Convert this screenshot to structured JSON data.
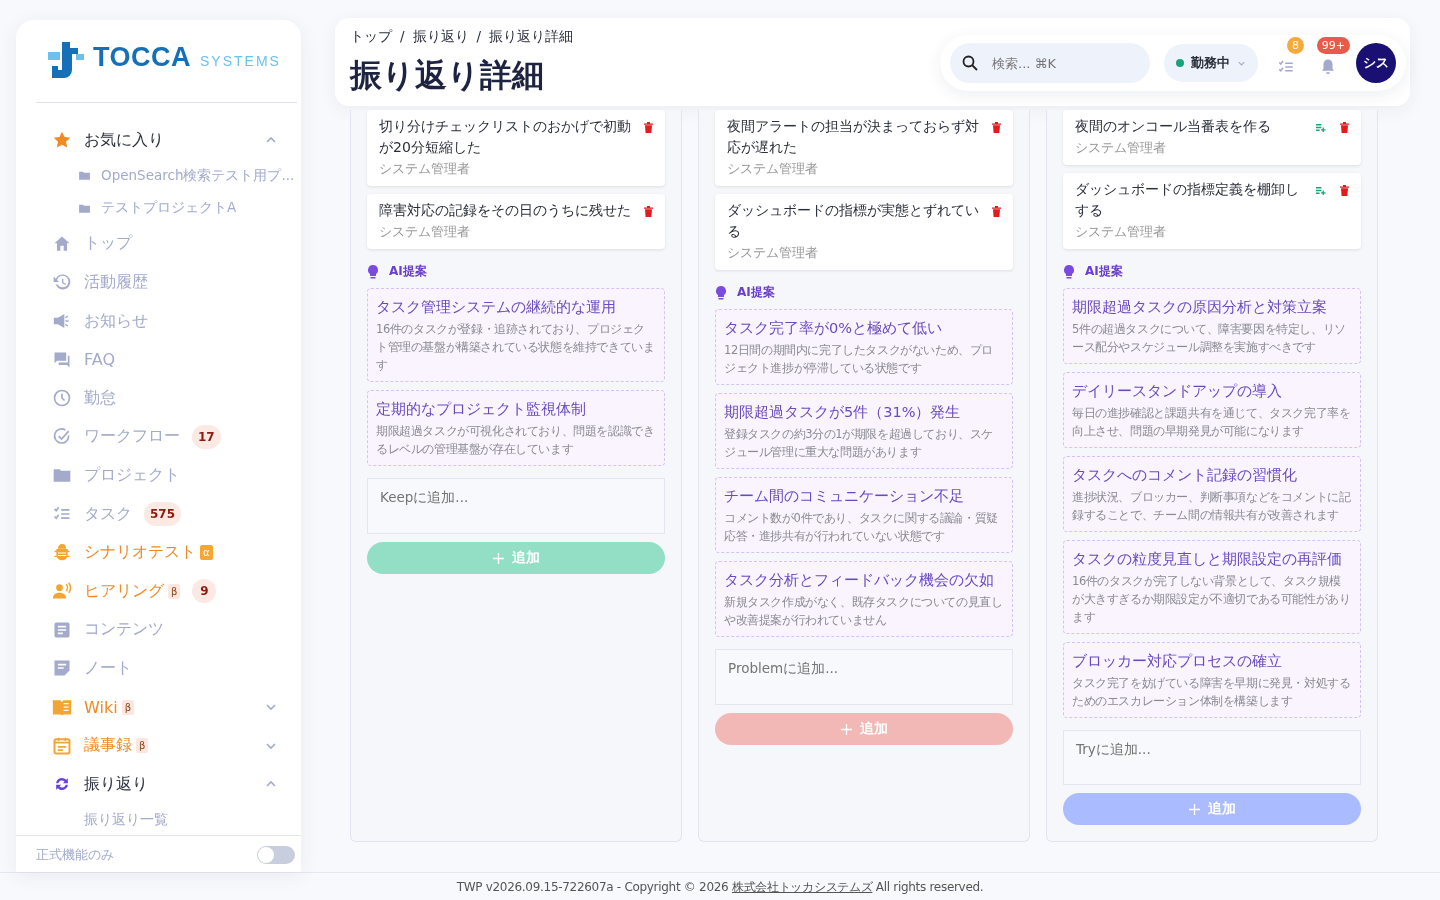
{
  "sidebar": {
    "logo": {
      "name": "TOCCA",
      "sub": "SYSTEMS"
    },
    "items": [
      {
        "label": "お気に入り",
        "expanded": true,
        "accent": false,
        "children": [
          {
            "label": "OpenSearch検索テスト用プ...",
            "kind": "project"
          },
          {
            "label": "テストプロジェクトA",
            "kind": "project"
          }
        ]
      },
      {
        "label": "トップ",
        "accent": false
      },
      {
        "label": "活動履歴",
        "accent": false
      },
      {
        "label": "お知らせ",
        "accent": false
      },
      {
        "label": "FAQ",
        "accent": false
      },
      {
        "label": "勤怠",
        "accent": false
      },
      {
        "label": "ワークフロー",
        "accent": false,
        "count": "17"
      },
      {
        "label": "プロジェクト",
        "accent": false
      },
      {
        "label": "タスク",
        "accent": false,
        "count": "575"
      },
      {
        "label": "シナリオテスト",
        "accent": true,
        "tag": {
          "text": "α",
          "kind": "alpha"
        }
      },
      {
        "label": "ヒアリング",
        "accent": true,
        "tag": {
          "text": "β",
          "kind": "beta"
        },
        "count": "9"
      },
      {
        "label": "コンテンツ",
        "accent": false
      },
      {
        "label": "ノート",
        "accent": false
      },
      {
        "label": "Wiki",
        "accent": true,
        "tag": {
          "text": "β",
          "kind": "beta"
        },
        "expanded": false
      },
      {
        "label": "議事録",
        "accent": true,
        "tag": {
          "text": "β",
          "kind": "beta"
        },
        "expanded": false
      },
      {
        "label": "振り返り",
        "accent": false,
        "expanded": true,
        "children": [
          {
            "label": "振り返り一覧",
            "kind": "page"
          }
        ]
      }
    ],
    "footer": {
      "label": "正式機能のみ",
      "on": false
    }
  },
  "header": {
    "breadcrumb": [
      "トップ",
      "振り返り",
      "振り返り詳細"
    ],
    "separator": "/",
    "title": "振り返り詳細",
    "search": {
      "placeholder": "検索... ⌘K"
    },
    "status": {
      "label": "勤務中",
      "color": "#1aa37a"
    },
    "task_badge": "8",
    "notification_badge": "99+",
    "avatar": "シス"
  },
  "columns": [
    {
      "kind": "keep",
      "cards": [
        {
          "text": "切り分けチェックリストのおかげで初動が20分短縮した",
          "author": "システム管理者",
          "can_add_task": false
        },
        {
          "text": "障害対応の記録をその日のうちに残せた",
          "author": "システム管理者",
          "can_add_task": false
        }
      ],
      "ai_label": "AI提案",
      "suggestions": [
        {
          "title": "タスク管理システムの継続的な運用",
          "body": "16件のタスクが登録・追跡されており、プロジェクト管理の基盤が構築されている状態を維持できています"
        },
        {
          "title": "定期的なプロジェクト監視体制",
          "body": "期限超過タスクが可視化されており、問題を認識できるレベルの管理基盤が存在しています"
        }
      ],
      "placeholder": "Keepに追加...",
      "button": "追加"
    },
    {
      "kind": "problem",
      "cards": [
        {
          "text": "夜間アラートの担当が決まっておらず対応が遅れた",
          "author": "システム管理者",
          "can_add_task": false
        },
        {
          "text": "ダッシュボードの指標が実態とずれている",
          "author": "システム管理者",
          "can_add_task": false
        }
      ],
      "ai_label": "AI提案",
      "suggestions": [
        {
          "title": "タスク完了率が0%と極めて低い",
          "body": "12日間の期間内に完了したタスクがないため、プロジェクト進捗が停滞している状態です"
        },
        {
          "title": "期限超過タスクが5件（31%）発生",
          "body": "登録タスクの約3分の1が期限を超過しており、スケジュール管理に重大な問題があります"
        },
        {
          "title": "チーム間のコミュニケーション不足",
          "body": "コメント数が0件であり、タスクに関する議論・質疑応答・進捗共有が行われていない状態です"
        },
        {
          "title": "タスク分析とフィードバック機会の欠如",
          "body": "新規タスク作成がなく、既存タスクについての見直しや改善提案が行われていません"
        }
      ],
      "placeholder": "Problemに追加...",
      "button": "追加"
    },
    {
      "kind": "try",
      "cards": [
        {
          "text": "夜間のオンコール当番表を作る",
          "author": "システム管理者",
          "can_add_task": true
        },
        {
          "text": "ダッシュボードの指標定義を棚卸しする",
          "author": "システム管理者",
          "can_add_task": true
        }
      ],
      "ai_label": "AI提案",
      "suggestions": [
        {
          "title": "期限超過タスクの原因分析と対策立案",
          "body": "5件の超過タスクについて、障害要因を特定し、リソース配分やスケジュール調整を実施すべきです"
        },
        {
          "title": "デイリースタンドアップの導入",
          "body": "毎日の進捗確認と課題共有を通じて、タスク完了率を向上させ、問題の早期発見が可能になります"
        },
        {
          "title": "タスクへのコメント記録の習慣化",
          "body": "進捗状況、ブロッカー、判断事項などをコメントに記録することで、チーム間の情報共有が改善されます"
        },
        {
          "title": "タスクの粒度見直しと期限設定の再評価",
          "body": "16件のタスクが完了しない背景として、タスク規模が大きすぎるか期限設定が不適切である可能性があります"
        },
        {
          "title": "ブロッカー対応プロセスの確立",
          "body": "タスク完了を妨げている障害を早期に発見・対処するためのエスカレーション体制を構築します"
        }
      ],
      "placeholder": "Tryに追加...",
      "button": "追加"
    }
  ],
  "footer": {
    "before": "TWP v2026.09.15-722607a - Copyright © 2026 ",
    "link": "株式会社トッカシステムズ",
    "after": " All rights reserved."
  }
}
